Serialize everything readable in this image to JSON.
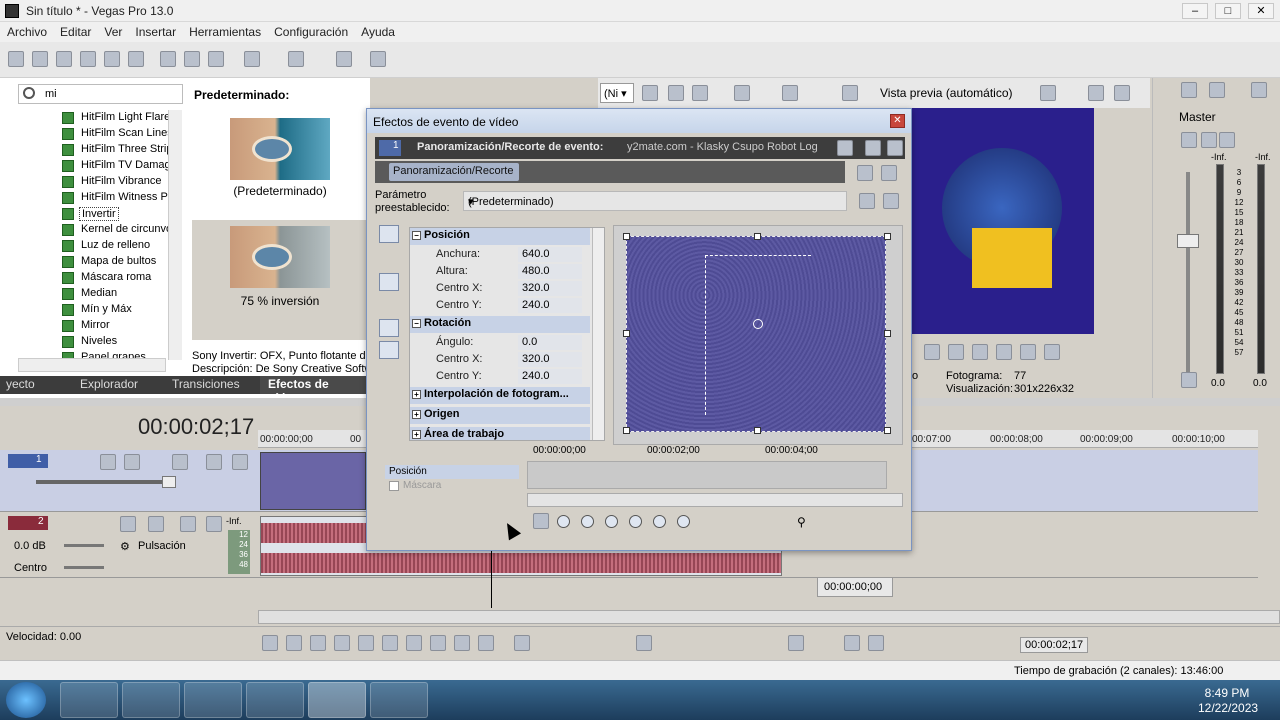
{
  "window": {
    "title": "Sin título * - Vegas Pro 13.0"
  },
  "menu": [
    "Archivo",
    "Editar",
    "Ver",
    "Insertar",
    "Herramientas",
    "Configuración",
    "Ayuda"
  ],
  "fx_panel": {
    "search_value": "mi",
    "presets_title": "Predeterminado:",
    "effects": [
      "HitFilm Light Flares",
      "HitFilm Scan Lines",
      "HitFilm Three Strip",
      "HitFilm TV Damage",
      "HitFilm Vibrance",
      "HitFilm Witness Pr",
      "Invertir",
      "Kernel de circunvol",
      "Luz de relleno",
      "Mapa de bultos",
      "Máscara roma",
      "Median",
      "Mín y Máx",
      "Mirror",
      "Niveles",
      "Panel grapes"
    ],
    "selected_effect": "Invertir",
    "preset_1_label": "(Predeterminado)",
    "preset_2_label": "75 % inversión",
    "desc_line1": "Sony Invertir: OFX, Punto flotante de",
    "desc_line2": "Descripción: De Sony Creative Softw",
    "tabs": [
      "yecto",
      "Explorador",
      "Transiciones",
      "Efectos de vídeo"
    ],
    "active_tab": "Efectos de vídeo"
  },
  "preview": {
    "zoom_select": "(Ni",
    "mode_label": "Vista previa (automático)",
    "frame_label": "Fotograma:",
    "frame_value": "77",
    "display_label": "Visualización:",
    "display_value": "301x226x32",
    "corner_label": "o"
  },
  "master": {
    "label": "Master",
    "left_peak": "-Inf.",
    "right_peak": "-Inf.",
    "scale": [
      "3",
      "6",
      "9",
      "12",
      "15",
      "18",
      "21",
      "24",
      "27",
      "30",
      "33",
      "36",
      "39",
      "42",
      "45",
      "48",
      "51",
      "54",
      "57"
    ],
    "bottom_left": "0.0",
    "bottom_right": "0.0"
  },
  "dialog": {
    "title": "Efectos de evento de vídeo",
    "track_number": "1",
    "chain_title": "Panoramización/Recorte de evento:",
    "chain_source": "y2mate.com - Klasky Csupo Robot Log",
    "fx_tag": "Panoramización/Recorte",
    "preset_label_1": "Parámetro",
    "preset_label_2": "preestablecido:",
    "preset_value": "(Predeterminado)",
    "sections": {
      "position": "Posición",
      "rotation": "Rotación",
      "interpolation": "Interpolación de fotogram...",
      "origin": "Origen",
      "workarea": "Área de trabajo"
    },
    "props": {
      "width_k": "Anchura:",
      "width_v": "640.0",
      "height_k": "Altura:",
      "height_v": "480.0",
      "cx_k": "Centro X:",
      "cx_v": "320.0",
      "cy_k": "Centro Y:",
      "cy_v": "240.0",
      "angle_k": "Ángulo:",
      "angle_v": "0.0",
      "rcx_k": "Centro X:",
      "rcx_v": "320.0",
      "rcy_k": "Centro Y:",
      "rcy_v": "240.0"
    },
    "kf_rows": [
      "Posición",
      "Máscara"
    ],
    "kf_ruler": [
      "00:00:00;00",
      "00:00:02;00",
      "00:00:04;00"
    ],
    "kf_time": "00:00:00;00"
  },
  "timeline": {
    "timecode": "00:00:02;17",
    "ruler": [
      "00:00:00;00",
      "00",
      "00:07:00",
      "00:00:08;00",
      "00:00:09;00",
      "00:00:10;00"
    ],
    "track2_level": "0.0 dB",
    "track2_pan": "Centro",
    "track2_mode": "Pulsación",
    "track2_peak": "-Inf.",
    "track2_scale": [
      "12",
      "24",
      "36",
      "48"
    ],
    "track_1_number": "1",
    "track_2_number": "2",
    "rate_label": "Velocidad: 0.00",
    "end_time": "00:00:02;17"
  },
  "status": {
    "record_time": "Tiempo de grabación (2 canales): 13:46:00"
  },
  "taskbar": {
    "time": "8:49 PM",
    "date": "12/22/2023"
  }
}
